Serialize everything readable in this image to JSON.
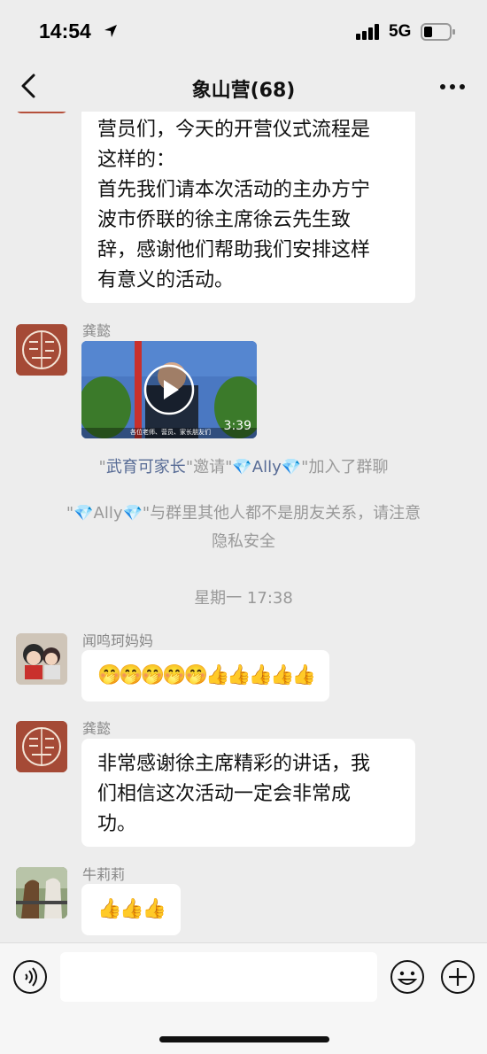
{
  "status": {
    "time": "14:54",
    "network": "5G"
  },
  "nav": {
    "title": "象山营(68)"
  },
  "messages": {
    "m1": {
      "lines": [
        "营员们，今天的开营仪式流程是",
        "这样的：",
        "首先我们请本次活动的主办方宁",
        "波市侨联的徐主席徐云先生致",
        "辞，感谢他们帮助我们安排这样",
        "有意义的活动。"
      ]
    },
    "m2": {
      "sender": "龚懿",
      "video_duration": "3:39",
      "video_caption": "各位老师、营员、家长朋友们"
    },
    "sys1": {
      "inviter": "武育可家长",
      "mid": "邀请",
      "invitee": "💎Ally💎",
      "tail": "加入了群聊",
      "q": "\""
    },
    "sys2": {
      "lines": [
        "\"💎Ally💎\"与群里其他人都不是朋友关系，请注意",
        "隐私安全"
      ]
    },
    "time_sep": "星期一 17:38",
    "m3": {
      "sender": "闻鸣珂妈妈",
      "content": "🤭🤭🤭🤭🤭👍👍👍👍👍"
    },
    "m4": {
      "sender": "龚懿",
      "lines": [
        "非常感谢徐主席精彩的讲话，我",
        "们相信这次活动一定会非常成",
        "功。"
      ]
    },
    "m5": {
      "sender": "牛莉莉",
      "content": "👍👍👍"
    }
  },
  "colors": {
    "bg": "#ededed",
    "bubble": "#ffffff",
    "link": "#576b95",
    "meta": "#999999"
  }
}
